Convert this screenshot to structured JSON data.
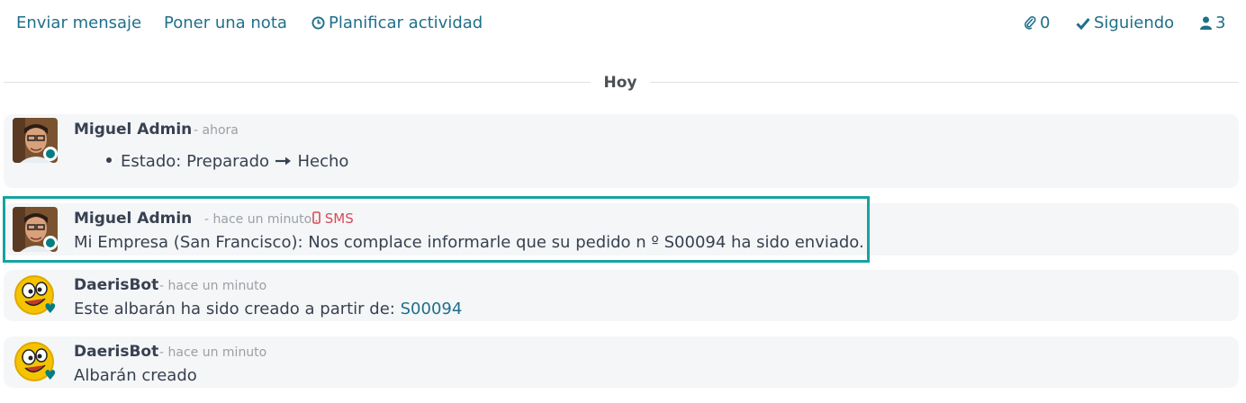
{
  "toolbar": {
    "send_message": "Enviar mensaje",
    "log_note": "Poner una nota",
    "schedule_activity": "Planificar actividad",
    "attachments_count": "0",
    "following": "Siguiendo",
    "followers_count": "3"
  },
  "date_separator": "Hoy",
  "messages": [
    {
      "author": "Miguel Admin",
      "time": "- ahora",
      "tracking_field": "Estado:",
      "old_value": "Preparado",
      "new_value": "Hecho"
    },
    {
      "author": "Miguel Admin",
      "time": "- hace un minuto",
      "channel": "SMS",
      "body": "Mi Empresa (San Francisco): Nos complace informarle que su pedido n º S00094 ha sido enviado."
    },
    {
      "author": "DaerisBot",
      "time": "- hace un minuto",
      "body_prefix": "Este albarán ha sido creado a partir de:",
      "body_link": "S00094"
    },
    {
      "author": "DaerisBot",
      "time": "- hace un minuto",
      "body": "Albarán creado"
    }
  ],
  "colors": {
    "link": "#1f6f8b",
    "online": "#017e84",
    "sms": "#d44c59",
    "highlight": "#17a2a2"
  },
  "icons": {
    "schedule": "clock-icon",
    "attachments": "paperclip-icon",
    "following": "check-icon",
    "followers": "user-icon",
    "sms": "mobile-phone-icon",
    "bot_status": "heart-icon"
  }
}
